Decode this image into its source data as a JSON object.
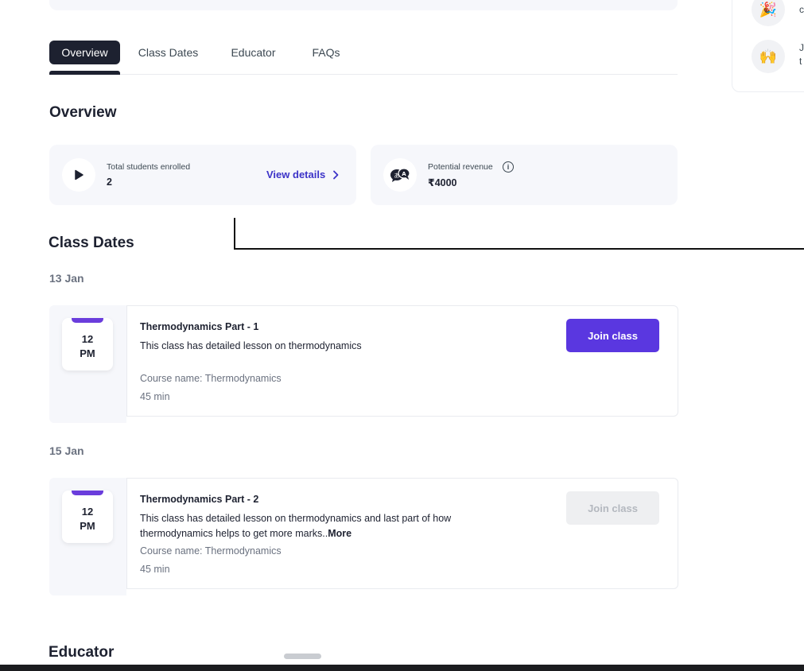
{
  "sidebar": {
    "items": [
      {
        "icon": "party-popper-icon",
        "glyph": "🎉",
        "text_line1": "",
        "text_line2": "c"
      },
      {
        "icon": "raised-hands-icon",
        "glyph": "🙌",
        "text_line1": "J",
        "text_line2": "t"
      }
    ]
  },
  "tabs": [
    {
      "label": "Overview",
      "active": true
    },
    {
      "label": "Class Dates",
      "active": false
    },
    {
      "label": "Educator",
      "active": false
    },
    {
      "label": "FAQs",
      "active": false
    }
  ],
  "overview": {
    "title": "Overview",
    "students": {
      "icon": "play-icon",
      "label": "Total students enrolled",
      "value": "2",
      "link_label": "View details"
    },
    "revenue": {
      "icon": "chat-bubbles-icon",
      "label": "Potential revenue",
      "value": "₹4000",
      "info_icon": "info-icon"
    }
  },
  "class_dates": {
    "title": "Class Dates",
    "groups": [
      {
        "date": "13 Jan",
        "time_hour": "12",
        "time_period": "PM",
        "title": "Thermodynamics Part - 1",
        "description": "This class has detailed lesson on thermodynamics",
        "more": "",
        "course": "Course name: Thermodynamics",
        "duration": "45 min",
        "button_label": "Join class",
        "button_enabled": true
      },
      {
        "date": "15 Jan",
        "time_hour": "12",
        "time_period": "PM",
        "title": "Thermodynamics Part - 2",
        "description": "This class has detailed lesson on thermodynamics and last part of how thermodynamics helps to get more marks..",
        "more": "More",
        "course": "Course name: Thermodynamics",
        "duration": "45 min",
        "button_label": "Join class",
        "button_enabled": false
      }
    ]
  },
  "educator": {
    "title": "Educator"
  },
  "colors": {
    "accent": "#5a37e0",
    "link": "#3c33c8",
    "tab_active": "#1d2130"
  }
}
